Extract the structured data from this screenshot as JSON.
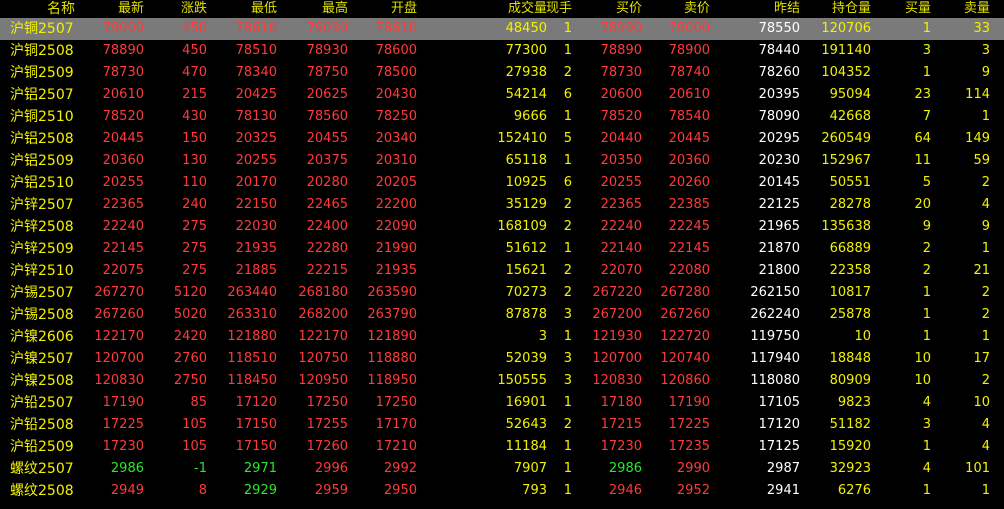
{
  "columns": [
    "名称",
    "最新",
    "涨跌",
    "最低",
    "最高",
    "开盘",
    "成交量",
    "现手",
    "买价",
    "卖价",
    "昨结",
    "持仓量",
    "买量",
    "卖量"
  ],
  "colors": {
    "up": "#ff3a3a",
    "down": "#29e829",
    "flat": "#ffffff",
    "yellow": "#f2f200",
    "selected_row": "#7a7a7a"
  },
  "rows": [
    {
      "name": "沪铜2507",
      "latest": "79000",
      "change": "450",
      "low": "78610",
      "high": "79030",
      "open": "78610",
      "volume": "48450",
      "hand": "1",
      "bid": "78990",
      "ask": "79000",
      "prev_settle": "78550",
      "oi": "120706",
      "bid_vol": "1",
      "ask_vol": "33"
    },
    {
      "name": "沪铜2508",
      "latest": "78890",
      "change": "450",
      "low": "78510",
      "high": "78930",
      "open": "78600",
      "volume": "77300",
      "hand": "1",
      "bid": "78890",
      "ask": "78900",
      "prev_settle": "78440",
      "oi": "191140",
      "bid_vol": "3",
      "ask_vol": "3"
    },
    {
      "name": "沪铜2509",
      "latest": "78730",
      "change": "470",
      "low": "78340",
      "high": "78750",
      "open": "78500",
      "volume": "27938",
      "hand": "2",
      "bid": "78730",
      "ask": "78740",
      "prev_settle": "78260",
      "oi": "104352",
      "bid_vol": "1",
      "ask_vol": "9"
    },
    {
      "name": "沪铝2507",
      "latest": "20610",
      "change": "215",
      "low": "20425",
      "high": "20625",
      "open": "20430",
      "volume": "54214",
      "hand": "6",
      "bid": "20600",
      "ask": "20610",
      "prev_settle": "20395",
      "oi": "95094",
      "bid_vol": "23",
      "ask_vol": "114"
    },
    {
      "name": "沪铜2510",
      "latest": "78520",
      "change": "430",
      "low": "78130",
      "high": "78560",
      "open": "78250",
      "volume": "9666",
      "hand": "1",
      "bid": "78520",
      "ask": "78540",
      "prev_settle": "78090",
      "oi": "42668",
      "bid_vol": "7",
      "ask_vol": "1"
    },
    {
      "name": "沪铝2508",
      "latest": "20445",
      "change": "150",
      "low": "20325",
      "high": "20455",
      "open": "20340",
      "volume": "152410",
      "hand": "5",
      "bid": "20440",
      "ask": "20445",
      "prev_settle": "20295",
      "oi": "260549",
      "bid_vol": "64",
      "ask_vol": "149"
    },
    {
      "name": "沪铝2509",
      "latest": "20360",
      "change": "130",
      "low": "20255",
      "high": "20375",
      "open": "20310",
      "volume": "65118",
      "hand": "1",
      "bid": "20350",
      "ask": "20360",
      "prev_settle": "20230",
      "oi": "152967",
      "bid_vol": "11",
      "ask_vol": "59"
    },
    {
      "name": "沪铝2510",
      "latest": "20255",
      "change": "110",
      "low": "20170",
      "high": "20280",
      "open": "20205",
      "volume": "10925",
      "hand": "6",
      "bid": "20255",
      "ask": "20260",
      "prev_settle": "20145",
      "oi": "50551",
      "bid_vol": "5",
      "ask_vol": "2"
    },
    {
      "name": "沪锌2507",
      "latest": "22365",
      "change": "240",
      "low": "22150",
      "high": "22465",
      "open": "22200",
      "volume": "35129",
      "hand": "2",
      "bid": "22365",
      "ask": "22385",
      "prev_settle": "22125",
      "oi": "28278",
      "bid_vol": "20",
      "ask_vol": "4"
    },
    {
      "name": "沪锌2508",
      "latest": "22240",
      "change": "275",
      "low": "22030",
      "high": "22400",
      "open": "22090",
      "volume": "168109",
      "hand": "2",
      "bid": "22240",
      "ask": "22245",
      "prev_settle": "21965",
      "oi": "135638",
      "bid_vol": "9",
      "ask_vol": "9"
    },
    {
      "name": "沪锌2509",
      "latest": "22145",
      "change": "275",
      "low": "21935",
      "high": "22280",
      "open": "21990",
      "volume": "51612",
      "hand": "1",
      "bid": "22140",
      "ask": "22145",
      "prev_settle": "21870",
      "oi": "66889",
      "bid_vol": "2",
      "ask_vol": "1"
    },
    {
      "name": "沪锌2510",
      "latest": "22075",
      "change": "275",
      "low": "21885",
      "high": "22215",
      "open": "21935",
      "volume": "15621",
      "hand": "2",
      "bid": "22070",
      "ask": "22080",
      "prev_settle": "21800",
      "oi": "22358",
      "bid_vol": "2",
      "ask_vol": "21"
    },
    {
      "name": "沪锡2507",
      "latest": "267270",
      "change": "5120",
      "low": "263440",
      "high": "268180",
      "open": "263590",
      "volume": "70273",
      "hand": "2",
      "bid": "267220",
      "ask": "267280",
      "prev_settle": "262150",
      "oi": "10817",
      "bid_vol": "1",
      "ask_vol": "2"
    },
    {
      "name": "沪锡2508",
      "latest": "267260",
      "change": "5020",
      "low": "263310",
      "high": "268200",
      "open": "263790",
      "volume": "87878",
      "hand": "3",
      "bid": "267200",
      "ask": "267260",
      "prev_settle": "262240",
      "oi": "25878",
      "bid_vol": "1",
      "ask_vol": "2"
    },
    {
      "name": "沪镍2606",
      "latest": "122170",
      "change": "2420",
      "low": "121880",
      "high": "122170",
      "open": "121890",
      "volume": "3",
      "hand": "1",
      "bid": "121930",
      "ask": "122720",
      "prev_settle": "119750",
      "oi": "10",
      "bid_vol": "1",
      "ask_vol": "1"
    },
    {
      "name": "沪镍2507",
      "latest": "120700",
      "change": "2760",
      "low": "118510",
      "high": "120750",
      "open": "118880",
      "volume": "52039",
      "hand": "3",
      "bid": "120700",
      "ask": "120740",
      "prev_settle": "117940",
      "oi": "18848",
      "bid_vol": "10",
      "ask_vol": "17"
    },
    {
      "name": "沪镍2508",
      "latest": "120830",
      "change": "2750",
      "low": "118450",
      "high": "120950",
      "open": "118950",
      "volume": "150555",
      "hand": "3",
      "bid": "120830",
      "ask": "120860",
      "prev_settle": "118080",
      "oi": "80909",
      "bid_vol": "10",
      "ask_vol": "2"
    },
    {
      "name": "沪铅2507",
      "latest": "17190",
      "change": "85",
      "low": "17120",
      "high": "17250",
      "open": "17250",
      "volume": "16901",
      "hand": "1",
      "bid": "17180",
      "ask": "17190",
      "prev_settle": "17105",
      "oi": "9823",
      "bid_vol": "4",
      "ask_vol": "10"
    },
    {
      "name": "沪铅2508",
      "latest": "17225",
      "change": "105",
      "low": "17150",
      "high": "17255",
      "open": "17170",
      "volume": "52643",
      "hand": "2",
      "bid": "17215",
      "ask": "17225",
      "prev_settle": "17120",
      "oi": "51182",
      "bid_vol": "3",
      "ask_vol": "4"
    },
    {
      "name": "沪铅2509",
      "latest": "17230",
      "change": "105",
      "low": "17150",
      "high": "17260",
      "open": "17210",
      "volume": "11184",
      "hand": "1",
      "bid": "17230",
      "ask": "17235",
      "prev_settle": "17125",
      "oi": "15920",
      "bid_vol": "1",
      "ask_vol": "4"
    },
    {
      "name": "螺纹2507",
      "latest": "2986",
      "change": "-1",
      "low": "2971",
      "high": "2996",
      "open": "2992",
      "volume": "7907",
      "hand": "1",
      "bid": "2986",
      "ask": "2990",
      "prev_settle": "2987",
      "oi": "32923",
      "bid_vol": "4",
      "ask_vol": "101"
    },
    {
      "name": "螺纹2508",
      "latest": "2949",
      "change": "8",
      "low": "2929",
      "high": "2959",
      "open": "2950",
      "volume": "793",
      "hand": "1",
      "bid": "2946",
      "ask": "2952",
      "prev_settle": "2941",
      "oi": "6276",
      "bid_vol": "1",
      "ask_vol": "1"
    }
  ]
}
